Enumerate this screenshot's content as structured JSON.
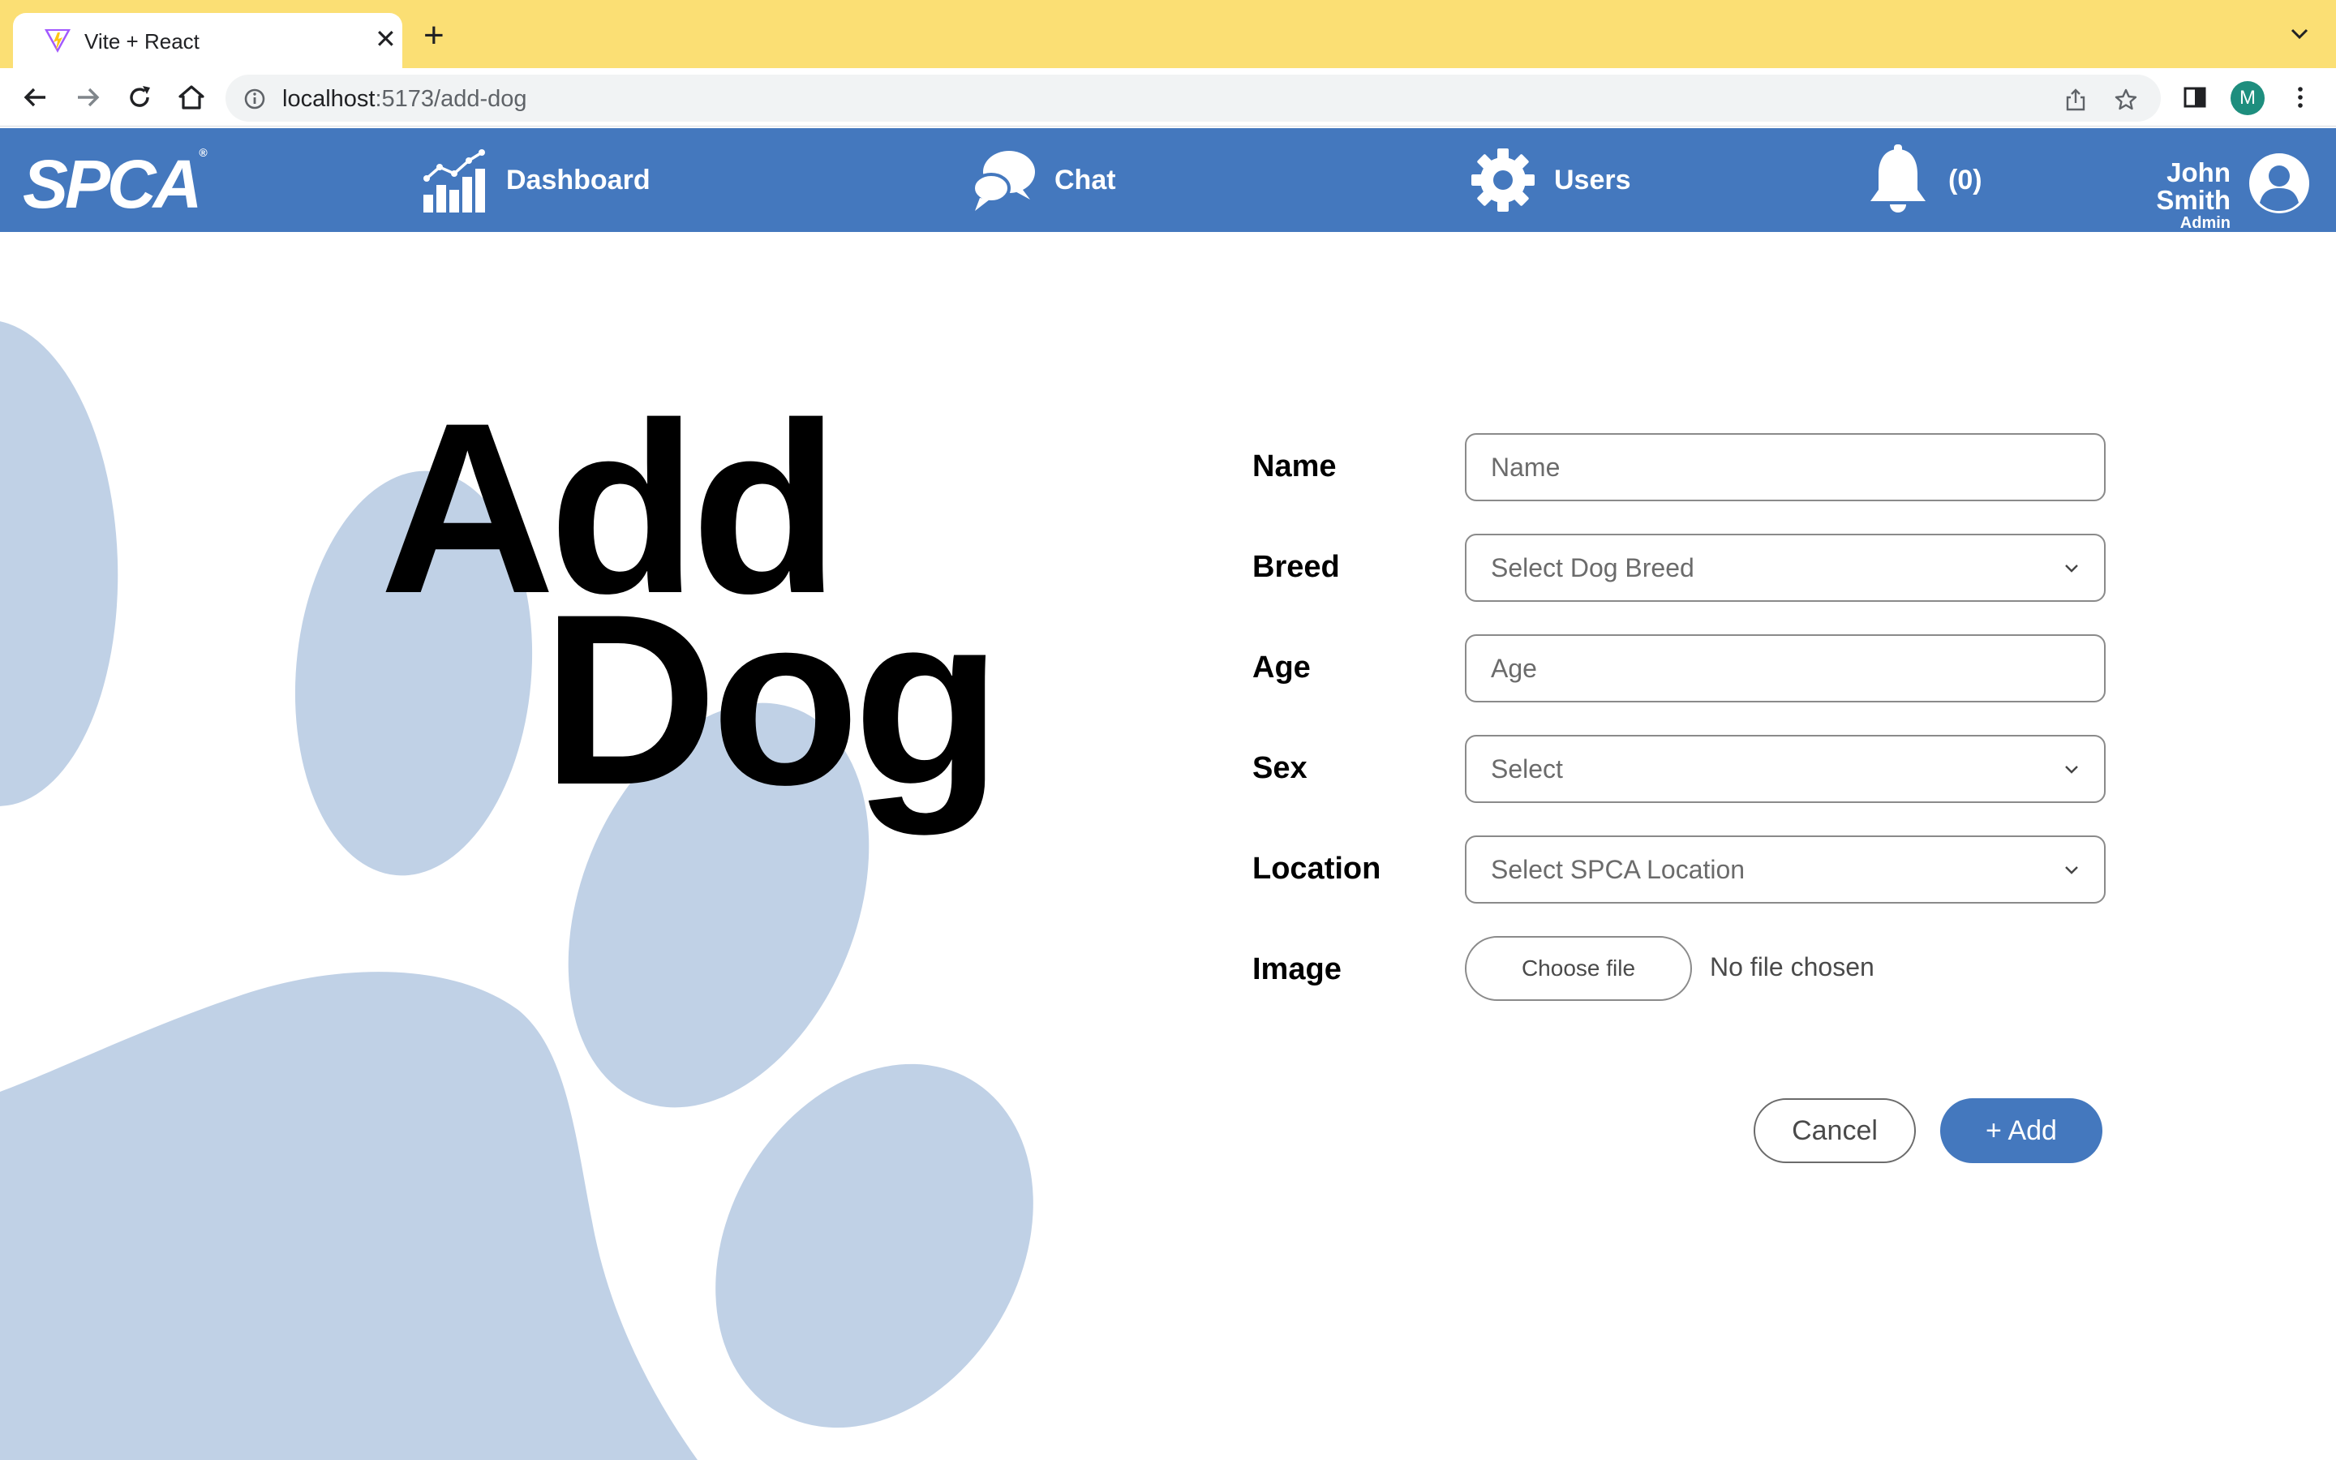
{
  "browser": {
    "tab_title": "Vite + React",
    "url_host": "localhost",
    "url_path": ":5173/add-dog",
    "profile_initial": "M"
  },
  "header": {
    "brand": "SPCA",
    "brand_mark": "®",
    "nav": [
      {
        "label": "Dashboard",
        "icon": "bar-chart-icon"
      },
      {
        "label": "Chat",
        "icon": "chat-bubbles-icon"
      },
      {
        "label": "Users",
        "icon": "gear-icon"
      }
    ],
    "notifications": {
      "icon": "bell-icon",
      "count_label": "(0)"
    },
    "user": {
      "name": "John Smith",
      "role": "Admin"
    }
  },
  "page": {
    "title_line1": "Add",
    "title_line2": "Dog"
  },
  "form": {
    "name": {
      "label": "Name",
      "placeholder": "Name"
    },
    "breed": {
      "label": "Breed",
      "value": "Select Dog Breed"
    },
    "age": {
      "label": "Age",
      "placeholder": "Age"
    },
    "sex": {
      "label": "Sex",
      "value": "Select"
    },
    "location": {
      "label": "Location",
      "value": "Select SPCA Location"
    },
    "image": {
      "label": "Image",
      "button": "Choose file",
      "status": "No file chosen"
    }
  },
  "actions": {
    "cancel": "Cancel",
    "add": "+ Add"
  },
  "colors": {
    "brand_blue": "#4478be",
    "paw_blue": "#c0d1e6",
    "tabstrip_yellow": "#fbdf74"
  }
}
